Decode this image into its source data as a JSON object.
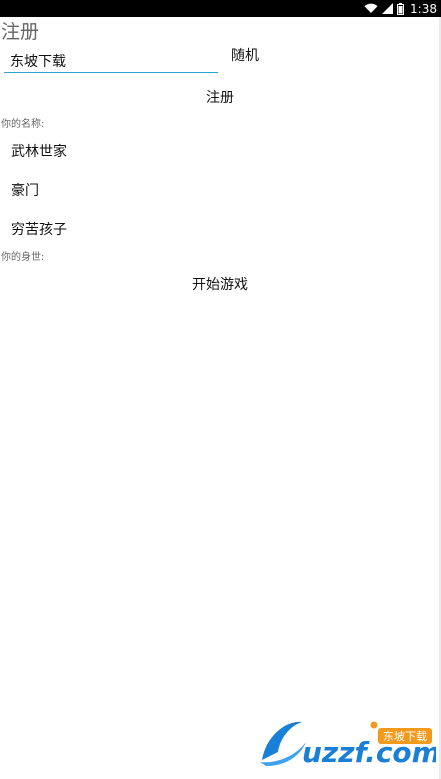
{
  "status_bar": {
    "time": "1:38"
  },
  "page": {
    "title": "注册"
  },
  "name_input": {
    "value": "东坡下载"
  },
  "buttons": {
    "random": "随机",
    "register": "注册",
    "start_game": "开始游戏"
  },
  "labels": {
    "your_name": "你的名称:",
    "your_background": "你的身世:"
  },
  "background_options": [
    "武林世家",
    "豪门",
    "穷苦孩子"
  ],
  "watermark": {
    "brand": "uzzf.com",
    "tag": "东坡下载"
  },
  "colors": {
    "status_bar_bg": "#000000",
    "input_underline": "#2aa7c9",
    "watermark_blue": "#1a7fd6",
    "watermark_orange": "#f39a1d"
  }
}
